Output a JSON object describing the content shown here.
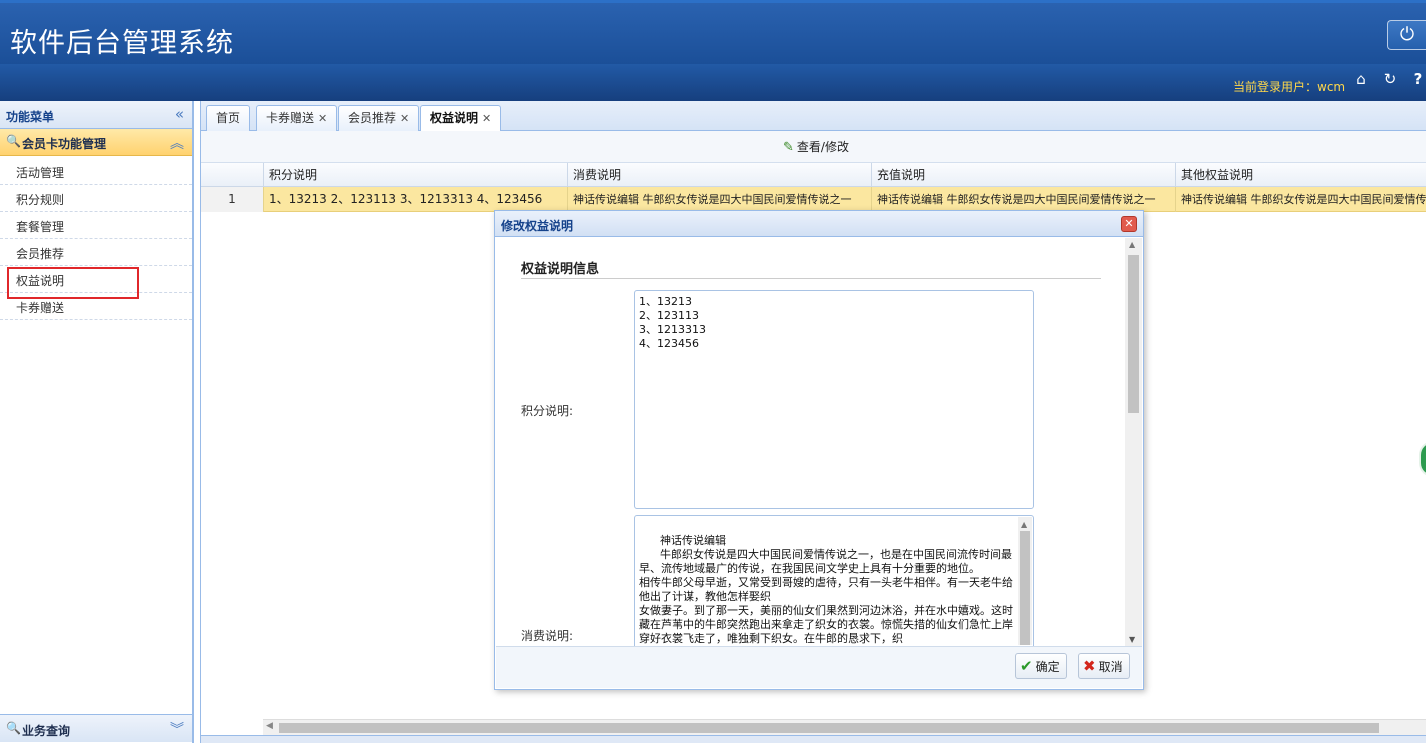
{
  "app": {
    "title": "软件后台管理系统"
  },
  "header": {
    "user_label": "当前登录用户：wcm",
    "power_icon": "⏻",
    "home_icon": "⌂",
    "refresh_icon": "↻",
    "help_icon": "?"
  },
  "sidebar": {
    "title": "功能菜单",
    "collapse_icon": "«",
    "group": {
      "label": "会员卡功能管理",
      "icon": "🔍",
      "toggle": "︽"
    },
    "items": [
      {
        "label": "活动管理"
      },
      {
        "label": "积分规则"
      },
      {
        "label": "套餐管理"
      },
      {
        "label": "会员推荐"
      },
      {
        "label": "权益说明"
      },
      {
        "label": "卡券赠送"
      }
    ],
    "bottom_group": {
      "label": "业务查询",
      "icon": "🔍",
      "toggle": "︾"
    }
  },
  "tabs": [
    {
      "label": "首页",
      "closable": false
    },
    {
      "label": "卡券赠送",
      "closable": true
    },
    {
      "label": "会员推荐",
      "closable": true
    },
    {
      "label": "权益说明",
      "closable": true,
      "selected": true
    }
  ],
  "toolbar": {
    "edit_label": "查看/修改",
    "edit_icon": "✎"
  },
  "grid": {
    "columns": [
      "积分说明",
      "消费说明",
      "充值说明",
      "其他权益说明"
    ],
    "rows": [
      {
        "num": "1",
        "cells": [
          "1、13213 2、123113 3、1213313 4、123456",
          "神话传说编辑 牛郎织女传说是四大中国民间爱情传说之一",
          "神话传说编辑 牛郎织女传说是四大中国民间爱情传说之一",
          "神话传说编辑 牛郎织女传说是四大中国民间爱情传说之一"
        ]
      }
    ]
  },
  "dialog": {
    "title": "修改权益说明",
    "close_icon": "✕",
    "section_title": "权益说明信息",
    "points_label": "积分说明:",
    "points_value": "1、13213\n2、123113\n3、1213313\n4、123456",
    "consume_label": "消费说明:",
    "consume_value": "神话传说编辑\n      牛郎织女传说是四大中国民间爱情传说之一，也是在中国民间流传时间最早、流传地域最广的传说，在我国民间文学史上具有十分重要的地位。\n相传牛郎父母早逝，又常受到哥嫂的虐待，只有一头老牛相伴。有一天老牛给他出了计谋，教他怎样娶织\n女做妻子。到了那一天，美丽的仙女们果然到河边沐浴，并在水中嬉戏。这时藏在芦苇中的牛郎突然跑出来拿走了织女的衣裳。惊慌失措的仙女们急忙上岸穿好衣裳飞走了，唯独剩下织女。在牛郎的恳求下，织",
    "ok_label": "确定",
    "ok_icon": "✔",
    "cancel_label": "取消",
    "cancel_icon": "✖"
  },
  "colors": {
    "header_blue": "#1f5097",
    "selected_row": "#fbe7a0",
    "group_gold": "#ffd26f",
    "highlight_red": "#e0272b"
  }
}
